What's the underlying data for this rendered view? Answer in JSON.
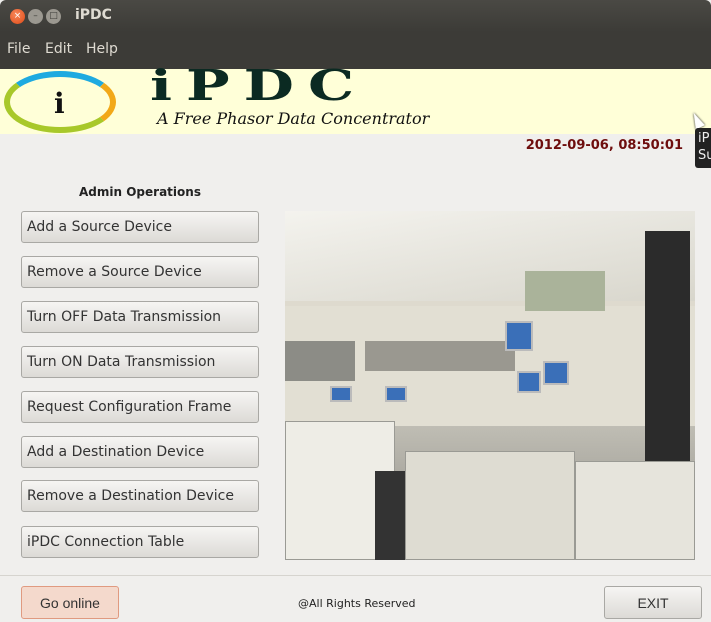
{
  "window": {
    "title": "iPDC",
    "close": "×",
    "minimize": "–",
    "maximize": "□"
  },
  "menu": [
    "File",
    "Edit",
    "Help"
  ],
  "banner": {
    "logo_letter": "i",
    "title": "iPDC",
    "subtitle": "A Free Phasor Data Concentrator"
  },
  "datetime": "2012-09-06, 08:50:01",
  "tooltip": {
    "line1": "iP",
    "line2": "Su"
  },
  "admin": {
    "heading": "Admin Operations",
    "buttons": [
      "Add a Source Device",
      "Remove a Source Device",
      "Turn OFF Data Transmission",
      "Turn ON Data Transmission",
      "Request Configuration Frame",
      "Add a Destination Device",
      "Remove a Destination Device",
      "iPDC Connection Table"
    ]
  },
  "footer": {
    "go_online": "Go online",
    "rights": "@All Rights Reserved",
    "exit": "EXIT"
  }
}
